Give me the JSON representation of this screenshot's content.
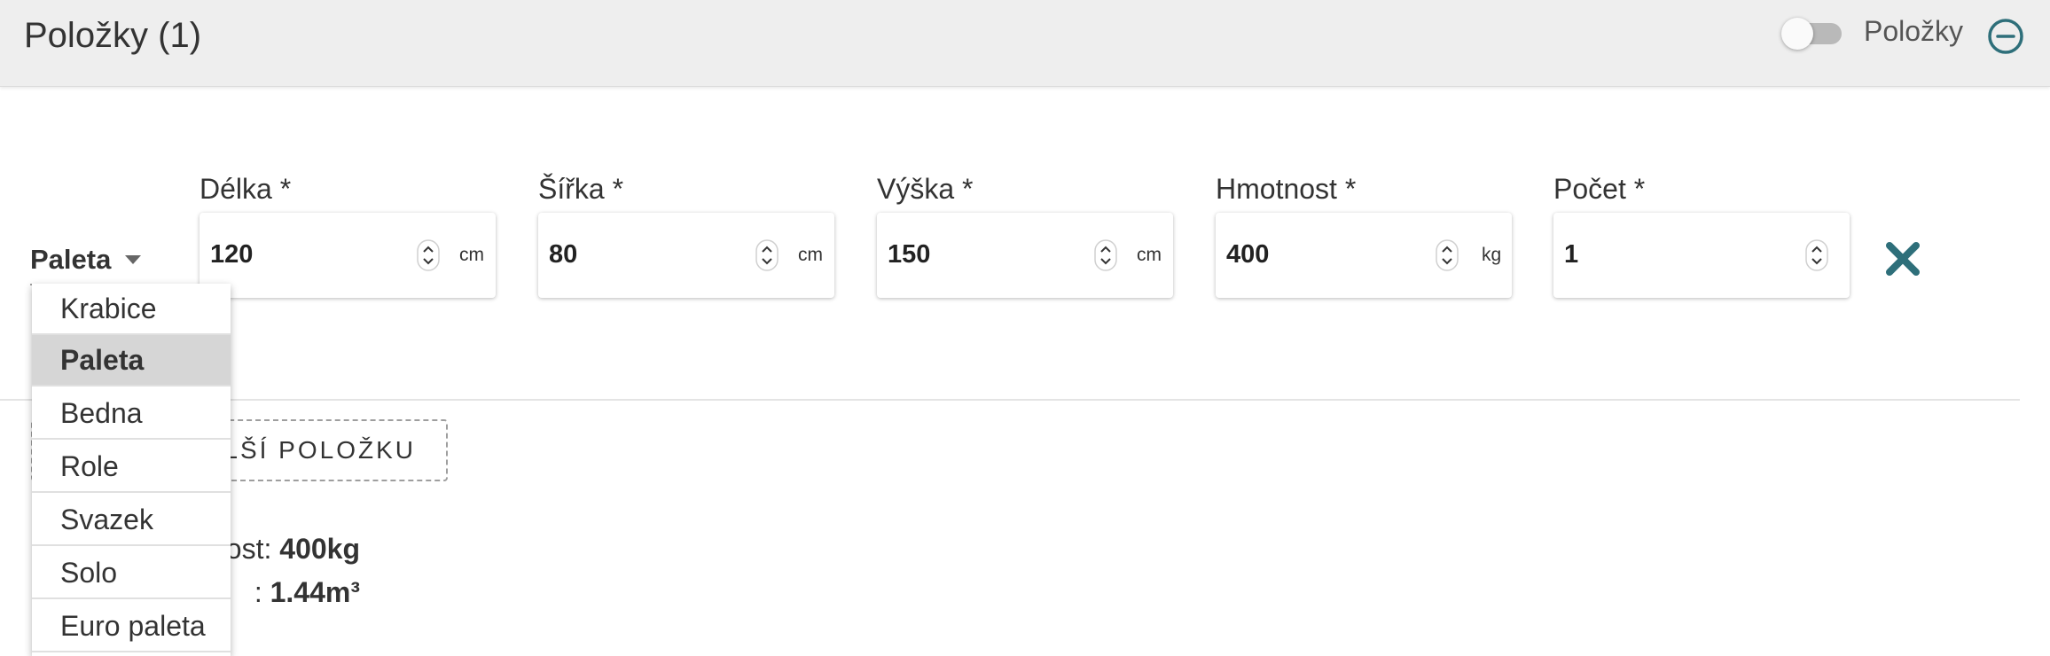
{
  "header": {
    "title": "Položky (1)",
    "toggle_label": "Položky",
    "toggle_on": false
  },
  "item": {
    "type": "Paleta",
    "fields": [
      {
        "label": "Délka *",
        "value": "120",
        "unit": "cm"
      },
      {
        "label": "Šířka *",
        "value": "80",
        "unit": "cm"
      },
      {
        "label": "Výška *",
        "value": "150",
        "unit": "cm"
      },
      {
        "label": "Hmotnost *",
        "value": "400",
        "unit": "kg"
      },
      {
        "label": "Počet *",
        "value": "1",
        "unit": ""
      }
    ]
  },
  "add_button_label": "ALŠÍ POLOŽKU",
  "summary": {
    "weight_label": "ost:",
    "weight_value": "400kg",
    "volume_label": ":",
    "volume_value": "1.44m³"
  },
  "dropdown": {
    "options": [
      "Krabice",
      "Paleta",
      "Bedna",
      "Role",
      "Svazek",
      "Solo",
      "Euro paleta"
    ],
    "selected": "Paleta"
  },
  "colors": {
    "header_bg": "#eeeeee",
    "accent": "#2e6f7a",
    "selected_option_bg": "#d6d6d6"
  },
  "icons": {
    "collapse": "minus-circle-icon",
    "remove": "close-icon",
    "caret": "caret-down-icon",
    "stepper": "up-down-chevron-icon"
  }
}
